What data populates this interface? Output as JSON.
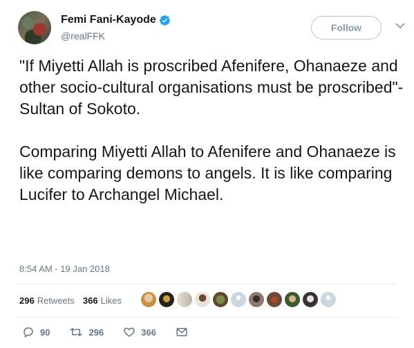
{
  "user": {
    "display_name": "Femi Fani-Kayode",
    "handle": "@realFFK",
    "verified": true
  },
  "follow_label": "Follow",
  "tweet": {
    "text": "\"If Miyetti Allah is proscribed Afenifere, Ohanaeze and other socio-cultural organisations must be proscribed\"- Sultan of Sokoto.\n\nComparing Miyetti Allah to Afenifere and Ohanaeze is like comparing demons to angels. It is like comparing Lucifer to Archangel Michael.",
    "timestamp": "8:54 AM - 19 Jan 2018"
  },
  "stats": {
    "retweets_count": "296",
    "retweets_label": "Retweets",
    "likes_count": "366",
    "likes_label": "Likes"
  },
  "actions": {
    "reply_count": "90",
    "retweet_count": "296",
    "like_count": "366"
  },
  "colors": {
    "verified_blue": "#1da1f2",
    "muted_text": "#657786",
    "divider": "#e6ecf0"
  }
}
